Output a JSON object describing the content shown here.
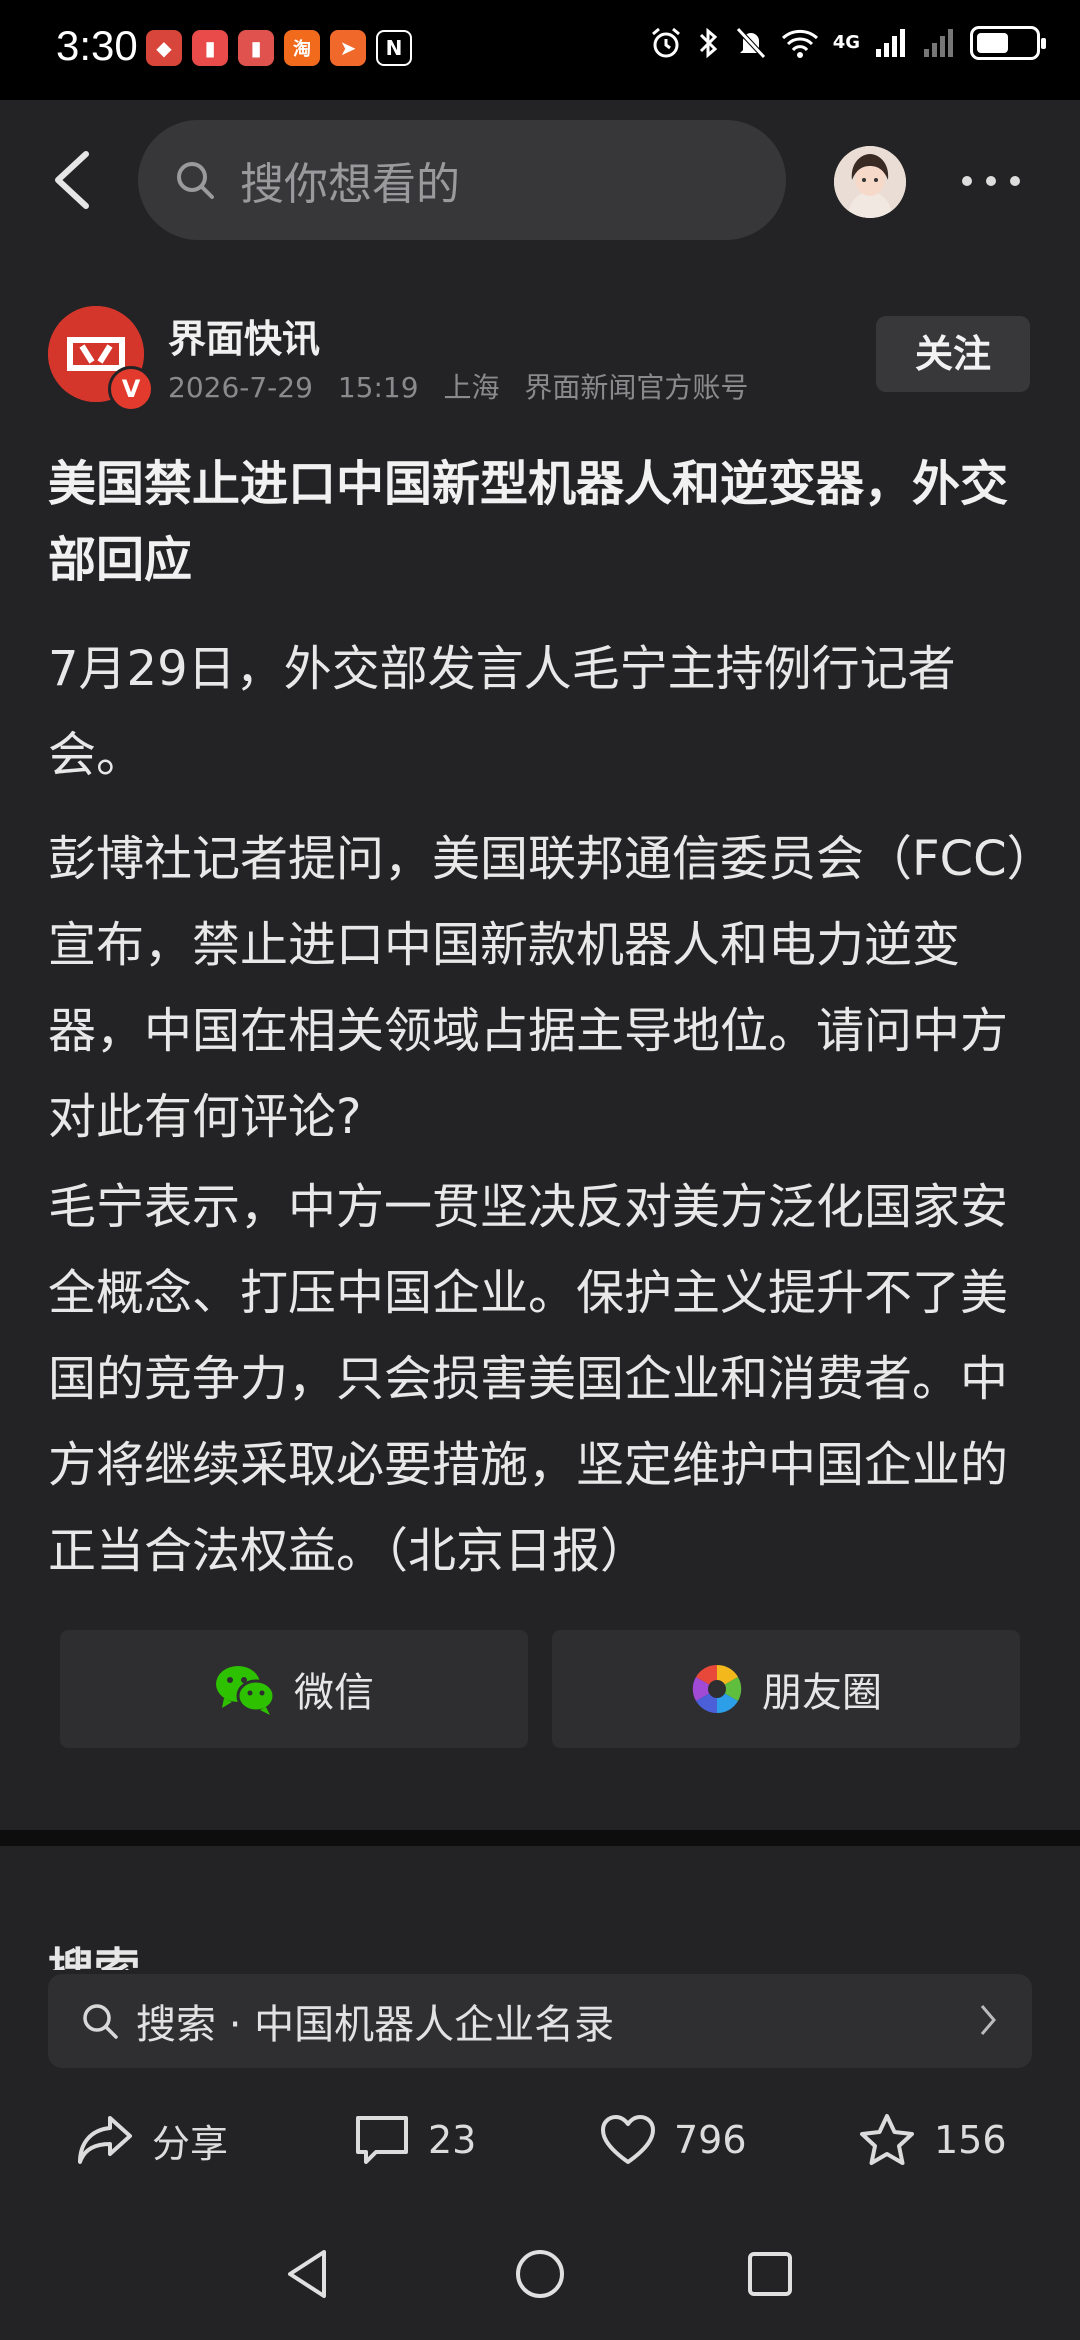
{
  "status_bar": {
    "time": "3:30",
    "app_icons": [
      {
        "name": "huawei-app-icon",
        "color": "#d8453a",
        "glyph": "◆"
      },
      {
        "name": "red-app-icon",
        "color": "#e94a4a",
        "glyph": "▮"
      },
      {
        "name": "red-app-icon-2",
        "color": "#e0524e",
        "glyph": "▮"
      },
      {
        "name": "taobao-icon",
        "color": "#f26b1d",
        "glyph": "淘"
      },
      {
        "name": "send-app-icon",
        "color": "#f0682a",
        "glyph": "➤"
      },
      {
        "name": "nfc-icon",
        "color": "#000000",
        "glyph": "N"
      }
    ],
    "network": "4G",
    "battery_level": 0.55
  },
  "header": {
    "search_placeholder": "搜你想看的"
  },
  "author": {
    "name": "界面快讯",
    "date": "2026-7-29",
    "time": "15:19",
    "location": "上海",
    "account_type": "界面新闻官方账号",
    "follow_label": "关注"
  },
  "article": {
    "title": "美国禁止进口中国新型机器人和逆变器，外交部回应",
    "paragraphs": [
      "7月29日，外交部发言人毛宁主持例行记者会。",
      "彭博社记者提问，美国联邦通信委员会（FCC）宣布，禁止进口中国新款机器人和电力逆变器，中国在相关领域占据主导地位。请问中方对此有何评论?",
      "毛宁表示，中方一贯坚决反对美方泛化国家安全概念、打压中国企业。保护主义提升不了美国的竞争力，只会损害美国企业和消费者。中方将继续采取必要措施，坚定维护中国企业的正当合法权益。（北京日报）"
    ]
  },
  "share": {
    "wechat_label": "微信",
    "moments_label": "朋友圈"
  },
  "section_peek": "搜索",
  "bottom_search": {
    "text": "搜索 · 中国机器人企业名录"
  },
  "actions": {
    "share_label": "分享",
    "comments": "23",
    "likes": "796",
    "favorites": "156"
  },
  "colors": {
    "background": "#232325",
    "accent_red": "#d4362c",
    "wechat_green": "#2dc100"
  }
}
